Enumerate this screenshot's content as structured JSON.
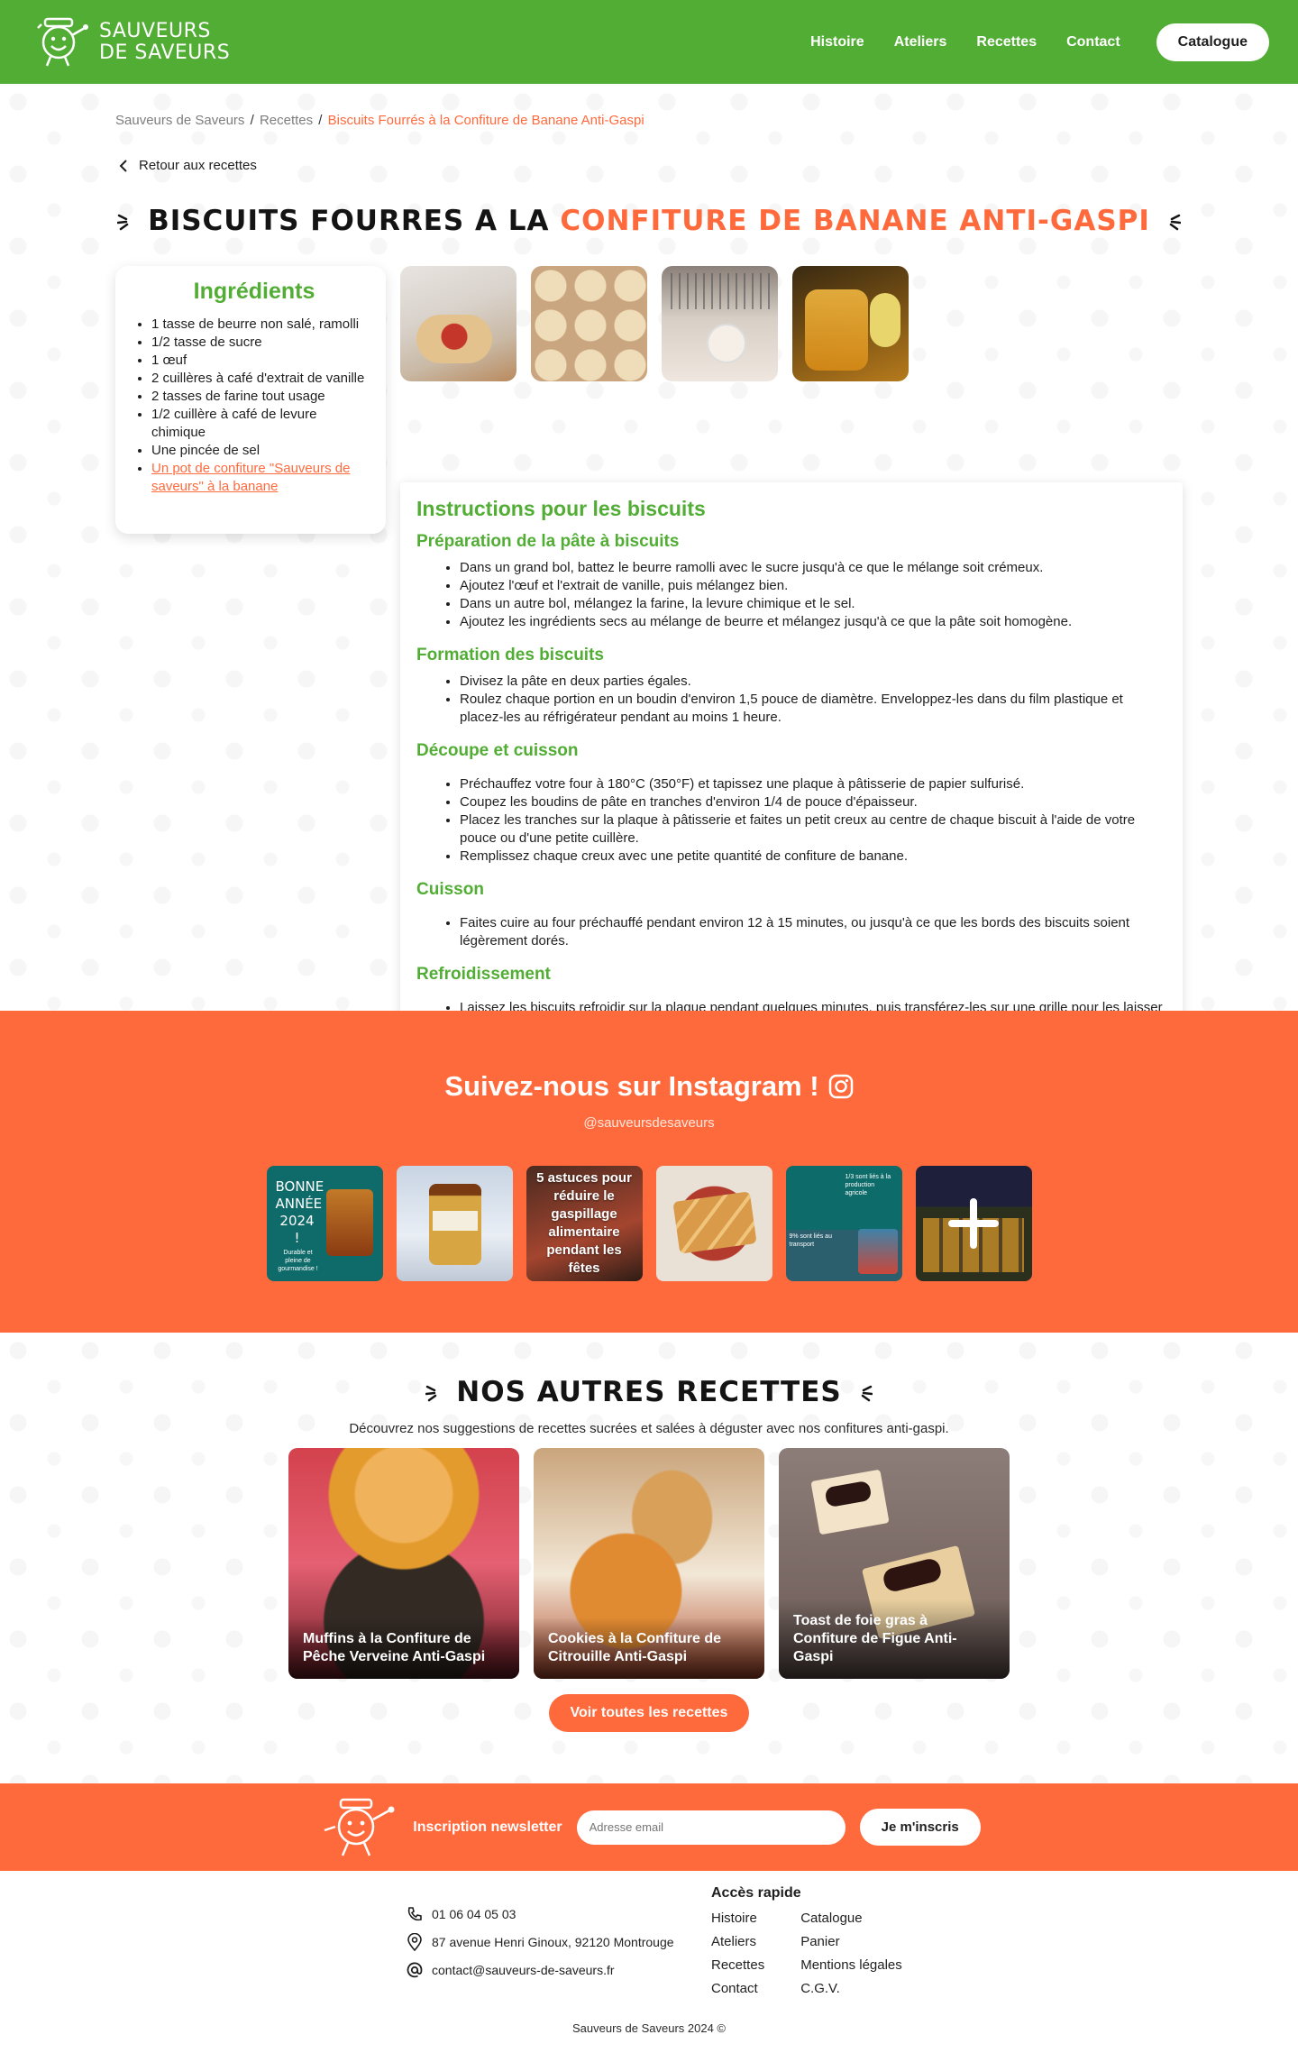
{
  "header": {
    "logo_line1": "SAUVEURS",
    "logo_line2": "DE SAVEURS",
    "nav": [
      "Histoire",
      "Ateliers",
      "Recettes",
      "Contact"
    ],
    "catalog_label": "Catalogue"
  },
  "breadcrumb": {
    "home": "Sauveurs de Saveurs",
    "section": "Recettes",
    "current": "Biscuits Fourrés à la Confiture de Banane Anti-Gaspi"
  },
  "back_label": "Retour aux recettes",
  "title": {
    "prefix": "BISCUITS FOURRES A LA",
    "accent": "CONFITURE DE BANANE ANTI-GASPI"
  },
  "ingredients": {
    "heading": "Ingrédients",
    "items": [
      "1 tasse de beurre non salé, ramolli",
      "1/2 tasse de sucre",
      "1 œuf",
      "2 cuillères à café d'extrait de vanille",
      "2 tasses de farine tout usage",
      "1/2 cuillère à café de levure chimique",
      "Une pincée de sel"
    ],
    "link": "Un pot de confiture \"Sauveurs de saveurs\" à la banane"
  },
  "instructions": {
    "heading": "Instructions pour les biscuits",
    "sections": [
      {
        "title": "Préparation de la pâte à biscuits",
        "steps": [
          "Dans un grand bol, battez le beurre ramolli avec le sucre jusqu'à ce que le mélange soit crémeux.",
          "Ajoutez l'œuf et l'extrait de vanille, puis mélangez bien.",
          "Dans un autre bol, mélangez la farine, la levure chimique et le sel.",
          "Ajoutez les ingrédients secs au mélange de beurre et mélangez jusqu'à ce que la pâte soit homogène."
        ]
      },
      {
        "title": "Formation des biscuits",
        "steps": [
          "Divisez la pâte en deux parties égales.",
          "Roulez chaque portion en un boudin d'environ 1,5 pouce de diamètre. Enveloppez-les dans du film plastique et placez-les au réfrigérateur pendant au moins 1 heure."
        ]
      },
      {
        "title": "Découpe et cuisson",
        "steps": [
          "Préchauffez votre four à 180°C (350°F) et tapissez une plaque à pâtisserie de papier sulfurisé.",
          "Coupez les boudins de pâte en tranches d'environ 1/4 de pouce d'épaisseur.",
          "Placez les tranches sur la plaque à pâtisserie et faites un petit creux au centre de chaque biscuit à l'aide de votre pouce ou d'une petite cuillère.",
          "Remplissez chaque creux avec une petite quantité de confiture de banane."
        ]
      },
      {
        "title": "Cuisson",
        "steps": [
          "Faites cuire au four préchauffé pendant environ 12 à 15 minutes, ou jusqu'à ce que les bords des biscuits soient légèrement dorés."
        ]
      },
      {
        "title": "Refroidissement",
        "steps": [
          "Laissez les biscuits refroidir sur la plaque pendant quelques minutes, puis transférez-les sur une grille pour les laisser refroidir complètement."
        ]
      }
    ]
  },
  "instagram": {
    "heading": "Suivez-nous sur Instagram !",
    "handle": "@sauveursdesaveurs",
    "tile1_text": "BONNE ANNÉE 2024 !",
    "tile1_sub": "Durable et pleine de gourmandise !",
    "tile3_text": "5 astuces pour réduire le gaspillage alimentaire pendant les fêtes",
    "tile5_top": "1/3 sont liés à la production agricole",
    "tile5_bottom": "9% sont liés au transport"
  },
  "others": {
    "title": "NOS AUTRES RECETTES",
    "intro": "Découvrez nos suggestions de recettes sucrées et salées à déguster avec nos confitures anti-gaspi.",
    "recipes": [
      "Muffins à la Confiture de Pêche Verveine Anti-Gaspi",
      "Cookies à la Confiture de Citrouille Anti-Gaspi",
      "Toast de foie gras à Confiture de Figue Anti-Gaspi"
    ],
    "see_all": "Voir toutes les recettes"
  },
  "newsletter": {
    "label": "Inscription newsletter",
    "placeholder": "Adresse email",
    "button": "Je m'inscris"
  },
  "footer": {
    "phone": "01 06 04 05 03",
    "address": "87 avenue Henri Ginoux, 92120 Montrouge",
    "email": "contact@sauveurs-de-saveurs.fr",
    "quick_heading": "Accès rapide",
    "col1": [
      "Histoire",
      "Ateliers",
      "Recettes",
      "Contact"
    ],
    "col2": [
      "Catalogue",
      "Panier",
      "Mentions légales",
      "C.G.V."
    ],
    "copyright": "Sauveurs de Saveurs 2024 ©"
  },
  "colors": {
    "green": "#52ad35",
    "orange": "#ff6a3d"
  },
  "icons": [
    "mascot-logo-icon",
    "chevron-left-icon",
    "sparkle-icon",
    "instagram-icon",
    "plus-icon",
    "phone-icon",
    "location-pin-icon",
    "at-sign-icon"
  ]
}
